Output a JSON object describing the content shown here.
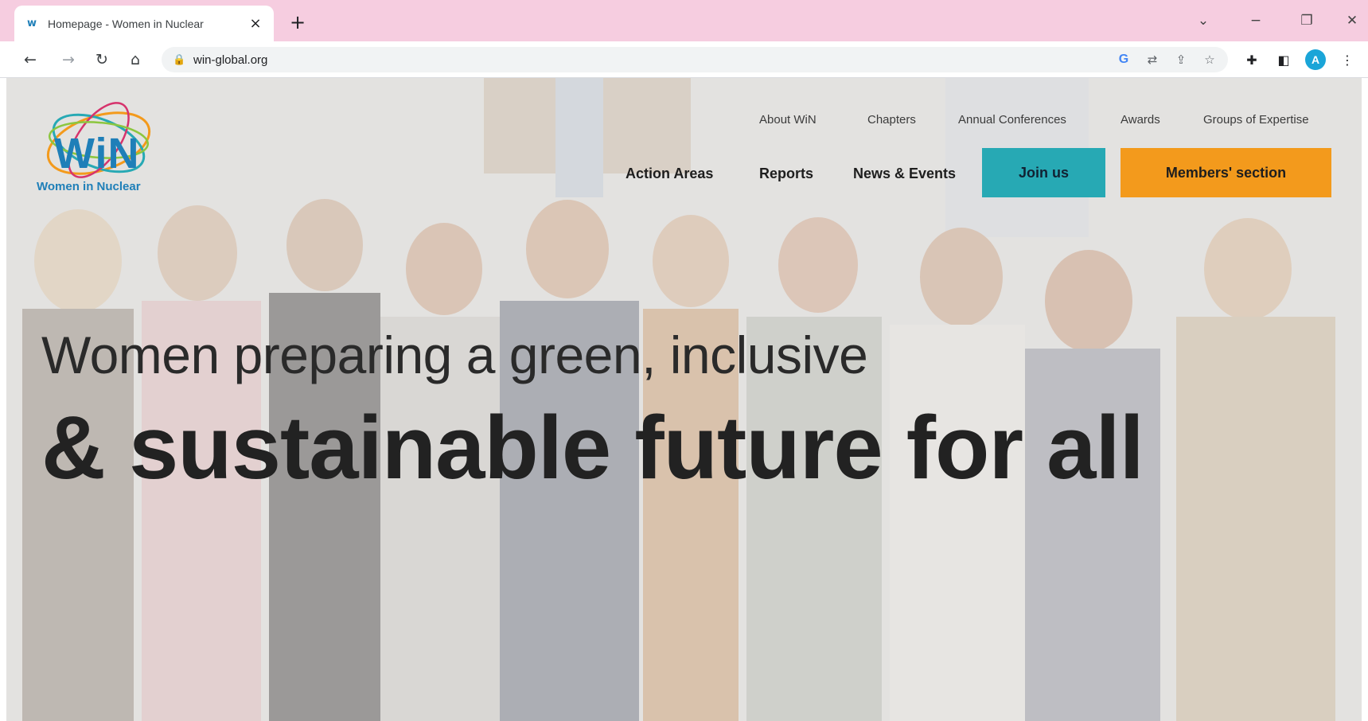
{
  "browser": {
    "tab": {
      "favicon": "w",
      "title": "Homepage - Women in Nuclear",
      "close_icon": "×"
    },
    "new_tab_icon": "+",
    "window_controls": {
      "tab_search_icon": "⌄",
      "minimize_icon": "−",
      "restore_icon": "❐",
      "close_icon": "✕"
    },
    "nav": {
      "back_icon": "←",
      "forward_icon": "→",
      "reload_icon": "↻",
      "home_icon": "⌂"
    },
    "address": {
      "lock_icon": "🔒",
      "url": "win-global.org"
    },
    "omnibox_icons": {
      "google_icon": "G",
      "translate_icon": "⇄",
      "share_icon": "⇪",
      "star_icon": "☆"
    },
    "extensions": {
      "puzzle_icon": "✚",
      "side_panel_icon": "◧",
      "avatar_letter": "A",
      "menu_icon": "⋮"
    }
  },
  "site": {
    "logo": {
      "word": "WiN",
      "tagline": "Women in Nuclear"
    },
    "top_nav": [
      "About WiN",
      "Chapters",
      "Annual Conferences",
      "Awards",
      "Groups of Expertise"
    ],
    "main_nav": [
      "Action Areas",
      "Reports",
      "News & Events"
    ],
    "join_label": "Join us",
    "members_label": "Members' section",
    "hero": {
      "line1": "Women preparing a green, inclusive",
      "line2": "& sustainable future for all"
    },
    "colors": {
      "brand_blue": "#1f7fb8",
      "join_teal": "#27a9b4",
      "members_orange": "#f39a1c"
    }
  }
}
